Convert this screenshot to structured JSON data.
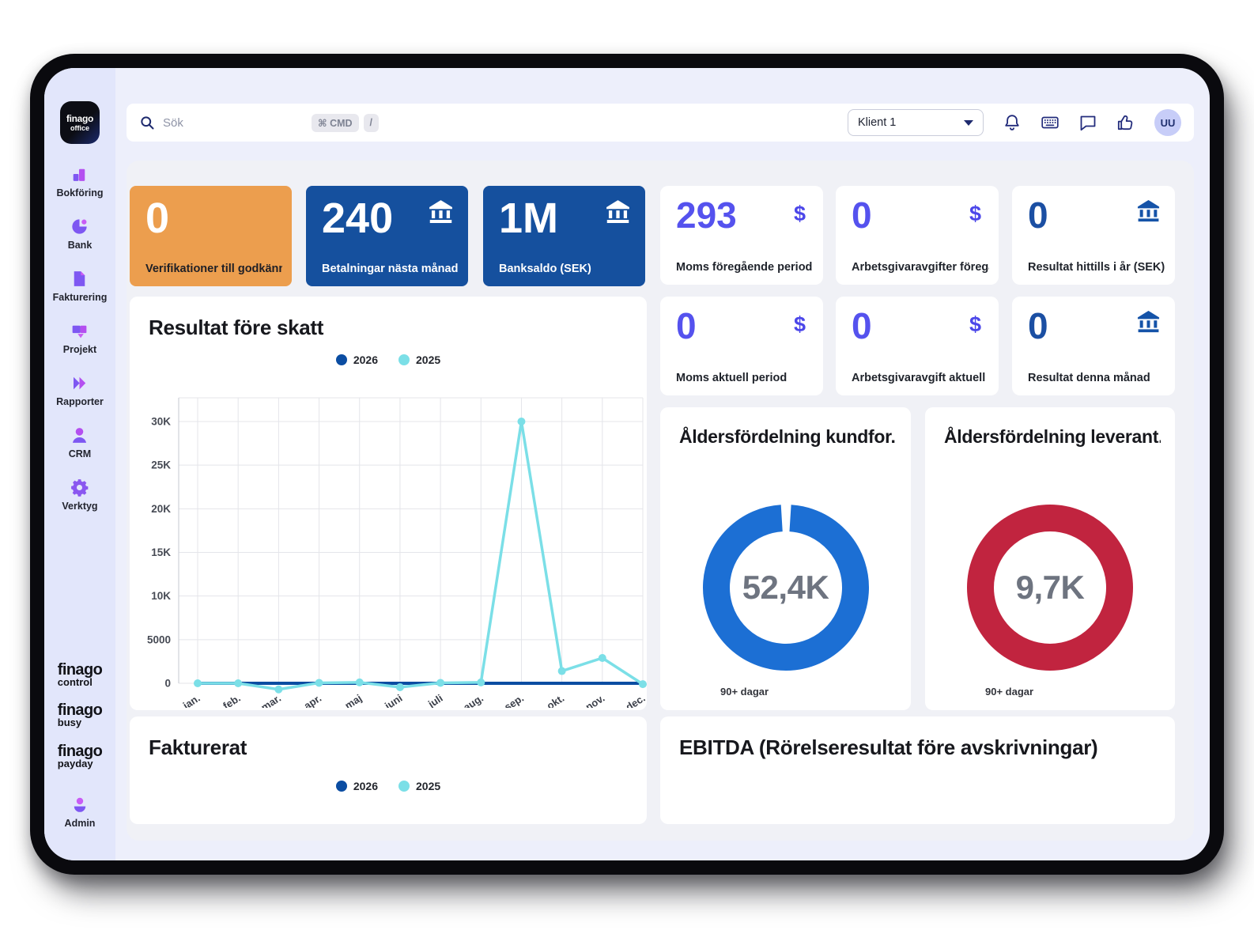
{
  "topbar": {
    "search_placeholder": "Sök",
    "cmd_chip": "⌘ CMD",
    "slash_chip": "/",
    "client_select": "Klient 1",
    "avatar_initials": "UU"
  },
  "sidebar": {
    "logo": {
      "line1": "finago",
      "line2": "office"
    },
    "items": [
      {
        "label": "Bokföring"
      },
      {
        "label": "Bank"
      },
      {
        "label": "Fakturering"
      },
      {
        "label": "Projekt"
      },
      {
        "label": "Rapporter"
      },
      {
        "label": "CRM"
      },
      {
        "label": "Verktyg"
      }
    ],
    "brands": [
      {
        "word": "finago",
        "sub": "control"
      },
      {
        "word": "finago",
        "sub": "busy"
      },
      {
        "word": "finago",
        "sub": "payday"
      }
    ],
    "admin_label": "Admin"
  },
  "kpis": {
    "dollar_symbol": "$",
    "highlight": [
      {
        "value": "0",
        "label": "Verifikationer till godkänning",
        "style": "orange"
      },
      {
        "value": "240",
        "label": "Betalningar nästa månad",
        "style": "blue",
        "icon": "bank"
      },
      {
        "value": "1M",
        "label": "Banksaldo (SEK)",
        "style": "blue",
        "icon": "bank"
      }
    ],
    "white": [
      {
        "value": "293",
        "label": "Moms föregående period (SEK)",
        "icon": "dollar"
      },
      {
        "value": "0",
        "label": "Arbetsgivaravgifter föregå...",
        "icon": "dollar"
      },
      {
        "value": "0",
        "label": "Resultat hittills i år (SEK)",
        "icon": "bank"
      },
      {
        "value": "0",
        "label": "Moms aktuell period",
        "icon": "dollar"
      },
      {
        "value": "0",
        "label": "Arbetsgivaravgift aktuell pe...",
        "icon": "dollar"
      },
      {
        "value": "0",
        "label": "Resultat denna månad",
        "icon": "bank"
      }
    ]
  },
  "chart_data": [
    {
      "type": "line",
      "title": "Resultat före skatt",
      "x_labels": [
        "jan.",
        "feb.",
        "mar.",
        "apr.",
        "maj",
        "juni",
        "juli",
        "aug.",
        "sep.",
        "okt.",
        "nov.",
        "dec."
      ],
      "series": [
        {
          "name": "2026",
          "color": "#0B4DA2",
          "values": [
            0,
            0,
            0,
            0,
            0,
            0,
            0,
            0,
            0,
            0,
            0,
            0
          ]
        },
        {
          "name": "2025",
          "color": "#7BDFE7",
          "values": [
            0,
            0,
            -700,
            50,
            100,
            -450,
            50,
            100,
            30000,
            1400,
            2900,
            -100
          ]
        }
      ],
      "y_ticks": [
        {
          "v": 0,
          "label": "0"
        },
        {
          "v": 5000,
          "label": "5000"
        },
        {
          "v": 10000,
          "label": "10K"
        },
        {
          "v": 15000,
          "label": "15K"
        },
        {
          "v": 20000,
          "label": "20K"
        },
        {
          "v": 25000,
          "label": "25K"
        },
        {
          "v": 30000,
          "label": "30K"
        }
      ],
      "ylim": [
        -2200,
        32500
      ],
      "grid": true,
      "legend_position": "top-center"
    },
    {
      "type": "donut",
      "title": "Åldersfördelning kundfor...",
      "center_value": "52,4K",
      "slice_label": "90+ dagar",
      "color": "#1C6FD4",
      "gap_fraction": 0.02
    },
    {
      "type": "donut",
      "title": "Åldersfördelning leverant...",
      "center_value": "9,7K",
      "slice_label": "90+ dagar",
      "color": "#C1243F",
      "gap_fraction": 0
    },
    {
      "type": "line",
      "title": "Fakturerat",
      "series": [
        {
          "name": "2026",
          "color": "#0B4DA2"
        },
        {
          "name": "2025",
          "color": "#7BDFE7"
        }
      ],
      "legend_position": "top-center"
    },
    {
      "type": "panel",
      "title": "EBITDA (Rörelseresultat före avskrivningar)"
    }
  ]
}
